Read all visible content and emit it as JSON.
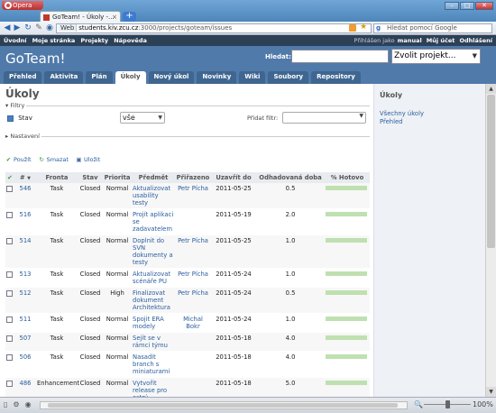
{
  "browser": {
    "menu_button": "Opera",
    "tab_title": "GoTeam! - Úkoly -...",
    "tab_close": "×",
    "new_tab": "+",
    "address_prefix": "Web",
    "url_host": "students.kiv.zcu.cz",
    "url_path": ":3000/projects/goteam/issues",
    "search_placeholder": "Hledat pomocí Google",
    "zoom_level": "100%",
    "window_controls": [
      "–",
      "□",
      "✕"
    ]
  },
  "top_menu": {
    "items": [
      "Úvodní",
      "Moje stránka",
      "Projekty",
      "Nápověda"
    ],
    "logged_in_prefix": "Přihlášen jako",
    "user": "manual",
    "account": "Můj účet",
    "logout": "Odhlášení"
  },
  "header": {
    "title": "GoTeam!",
    "search_label": "Hledat:",
    "project_select": "Zvolit projekt..."
  },
  "main_menu": [
    {
      "label": "Přehled",
      "selected": false
    },
    {
      "label": "Aktivita",
      "selected": false
    },
    {
      "label": "Plán",
      "selected": false
    },
    {
      "label": "Úkoly",
      "selected": true
    },
    {
      "label": "Nový úkol",
      "selected": false
    },
    {
      "label": "Novinky",
      "selected": false
    },
    {
      "label": "Wiki",
      "selected": false
    },
    {
      "label": "Soubory",
      "selected": false
    },
    {
      "label": "Repository",
      "selected": false
    }
  ],
  "page": {
    "title": "Úkoly",
    "filters_legend": "Filtry",
    "filter_stav_label": "Stav",
    "filter_operator": "vše",
    "add_filter_label": "Přidat filtr:",
    "settings_legend": "Nastavení",
    "actions": {
      "apply": "Použít",
      "clear": "Smazat",
      "save": "Uložit"
    }
  },
  "table": {
    "headers": [
      "#",
      "Fronta",
      "Stav",
      "Priorita",
      "Předmět",
      "Přiřazeno",
      "Uzavřít do",
      "Odhadovaná doba",
      "% Hotovo"
    ],
    "rows": [
      {
        "id": "546",
        "tracker": "Task",
        "status": "Closed",
        "priority": "Normal",
        "subject": "Aktualizovat usability testy",
        "assignee": "Petr Pícha",
        "due": "2011-05-25",
        "estimate": "0.5",
        "done": 1
      },
      {
        "id": "516",
        "tracker": "Task",
        "status": "Closed",
        "priority": "Normal",
        "subject": "Projít aplikaci se zadavatelem",
        "assignee": "",
        "due": "2011-05-19",
        "estimate": "2.0",
        "done": 1
      },
      {
        "id": "514",
        "tracker": "Task",
        "status": "Closed",
        "priority": "Normal",
        "subject": "Doplnit do SVN dokumenty a testy",
        "assignee": "Petr Pícha",
        "due": "2011-05-25",
        "estimate": "1.0",
        "done": 1
      },
      {
        "id": "513",
        "tracker": "Task",
        "status": "Closed",
        "priority": "Normal",
        "subject": "Aktualizovat scénáře PU",
        "assignee": "Petr Pícha",
        "due": "2011-05-24",
        "estimate": "1.0",
        "done": 1
      },
      {
        "id": "512",
        "tracker": "Task",
        "status": "Closed",
        "priority": "High",
        "subject": "Finalizovat dokument Architektura",
        "assignee": "Petr Pícha",
        "due": "2011-05-24",
        "estimate": "0.5",
        "done": 1
      },
      {
        "id": "511",
        "tracker": "Task",
        "status": "Closed",
        "priority": "Normal",
        "subject": "Spojit ERA modely",
        "assignee": "Michal Bokr",
        "due": "2011-05-24",
        "estimate": "1.0",
        "done": 1
      },
      {
        "id": "507",
        "tracker": "Task",
        "status": "Closed",
        "priority": "Normal",
        "subject": "Sejít se v rámci týmu",
        "assignee": "",
        "due": "2011-05-18",
        "estimate": "4.0",
        "done": 1
      },
      {
        "id": "506",
        "tracker": "Task",
        "status": "Closed",
        "priority": "Normal",
        "subject": "Nasadit branch s miniaturami",
        "assignee": "",
        "due": "2011-05-18",
        "estimate": "4.0",
        "done": 1
      },
      {
        "id": "486",
        "tracker": "Enhancement",
        "status": "Closed",
        "priority": "Normal",
        "subject": "Vytvořit release pro ostrý",
        "assignee": "",
        "due": "2011-05-18",
        "estimate": "5.0",
        "done": 1
      }
    ]
  },
  "sidebar": {
    "title": "Úkoly",
    "links": [
      "Všechny úkoly",
      "Přehled"
    ]
  }
}
